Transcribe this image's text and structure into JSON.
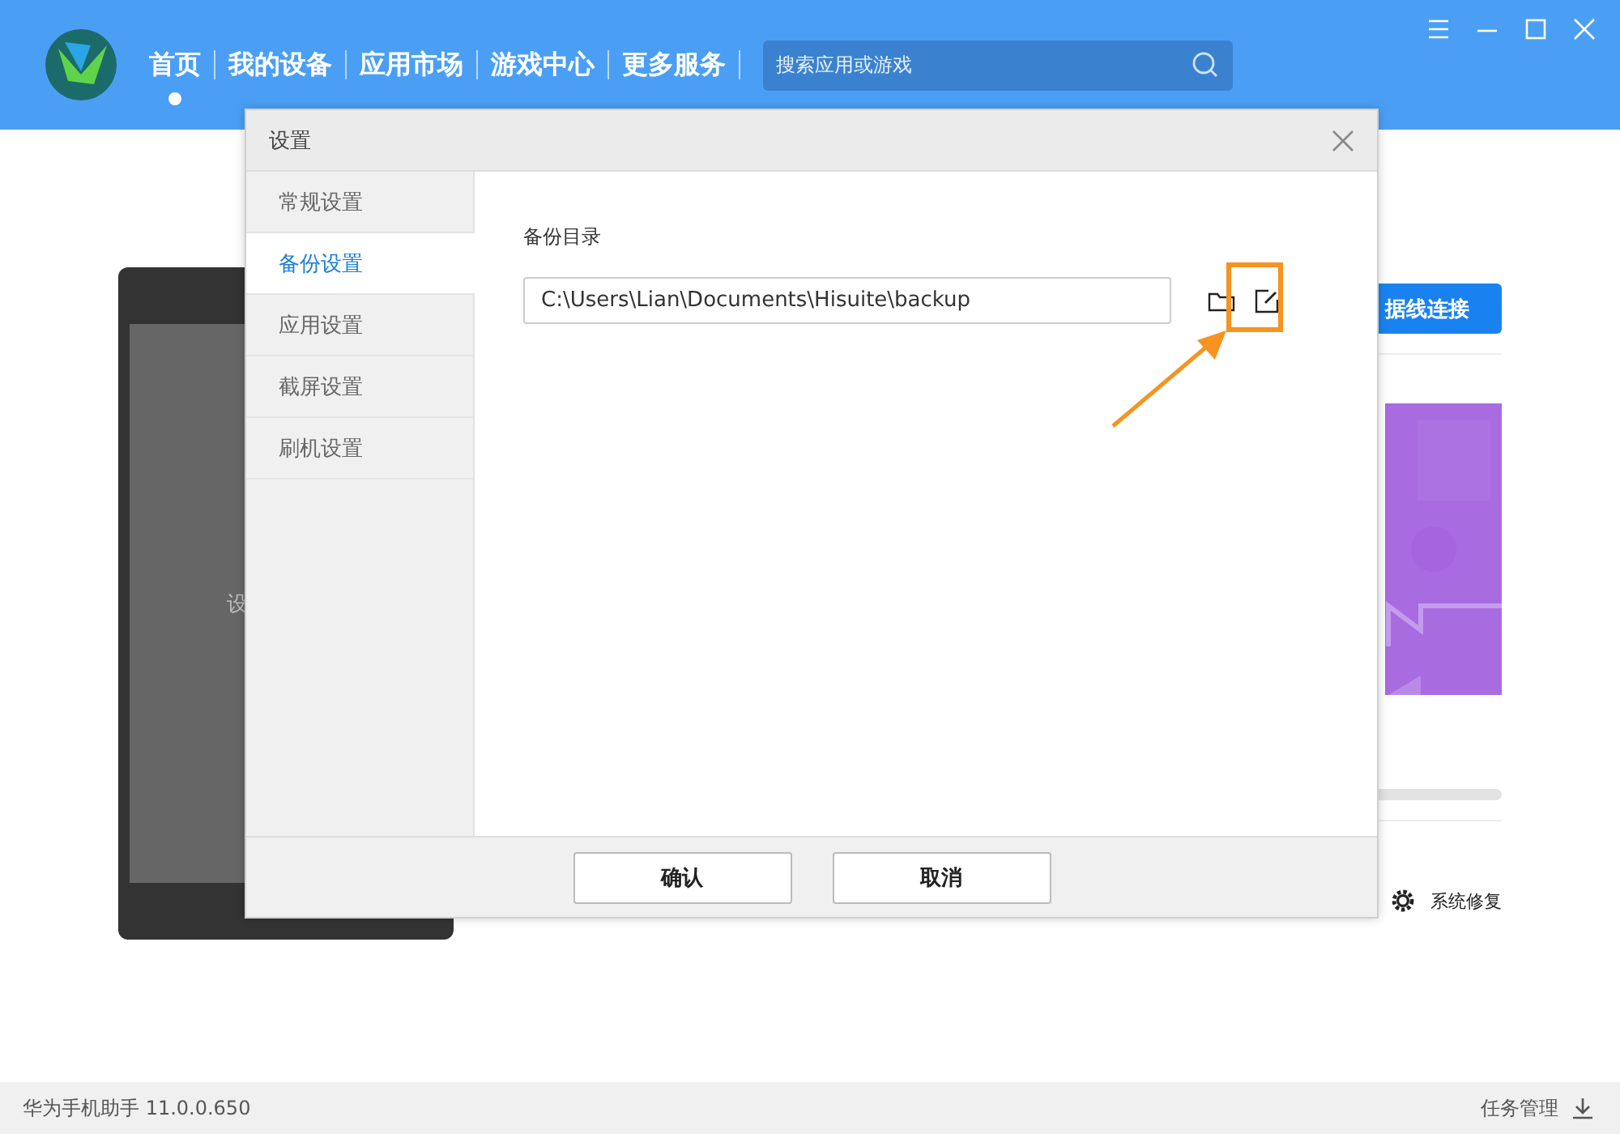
{
  "header": {
    "nav": [
      {
        "label": "首页",
        "selected": true
      },
      {
        "label": "我的设备",
        "selected": false
      },
      {
        "label": "应用市场",
        "selected": false
      },
      {
        "label": "游戏中心",
        "selected": false
      },
      {
        "label": "更多服务",
        "selected": false
      }
    ],
    "search": {
      "placeholder": "搜索应用或游戏"
    }
  },
  "background": {
    "phone_text": "设",
    "connect_button": "据线连接",
    "repair_label": "系统修复"
  },
  "dialog": {
    "title": "设置",
    "tabs": [
      {
        "label": "常规设置",
        "selected": false
      },
      {
        "label": "备份设置",
        "selected": true
      },
      {
        "label": "应用设置",
        "selected": false
      },
      {
        "label": "截屏设置",
        "selected": false
      },
      {
        "label": "刷机设置",
        "selected": false
      }
    ],
    "section_label": "备份目录",
    "path": {
      "value": "C:\\Users\\Lian\\Documents\\Hisuite\\backup"
    },
    "buttons": [
      "确认",
      "取消"
    ]
  },
  "status_bar": {
    "app_name": "华为手机助手 11.0.0.650",
    "task_manager": "任务管理"
  }
}
